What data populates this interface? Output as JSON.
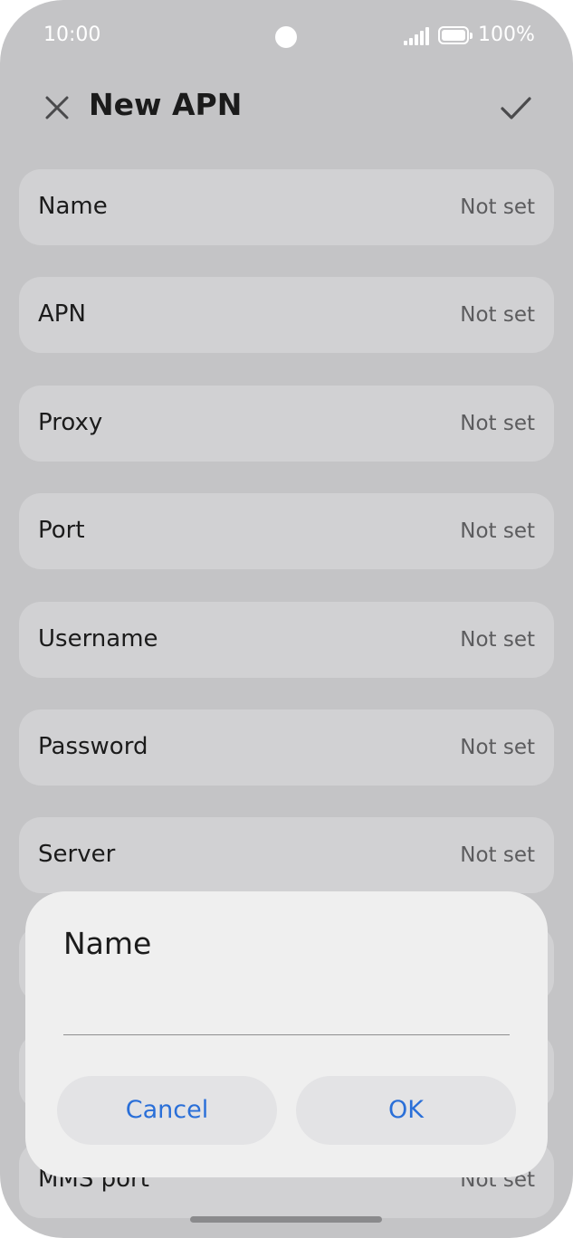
{
  "status_bar": {
    "time": "10:00",
    "battery_percent": "100%"
  },
  "header": {
    "title": "New APN"
  },
  "settings_rows": [
    {
      "label": "Name",
      "value": "Not set"
    },
    {
      "label": "APN",
      "value": "Not set"
    },
    {
      "label": "Proxy",
      "value": "Not set"
    },
    {
      "label": "Port",
      "value": "Not set"
    },
    {
      "label": "Username",
      "value": "Not set"
    },
    {
      "label": "Password",
      "value": "Not set"
    },
    {
      "label": "Server",
      "value": "Not set"
    },
    {
      "label": "",
      "value": ""
    },
    {
      "label": "",
      "value": ""
    },
    {
      "label": "MMS port",
      "value": "Not set"
    }
  ],
  "dialog": {
    "title": "Name",
    "input_value": "",
    "cancel_label": "Cancel",
    "ok_label": "OK"
  },
  "colors": {
    "accent": "#2a6fd8",
    "background_dimmed": "#c4c4c6",
    "row_background": "#d1d1d3",
    "dialog_background": "#efefef"
  },
  "icons": {
    "close": "close-icon",
    "confirm": "checkmark-icon",
    "signal": "signal-icon",
    "battery": "battery-icon"
  }
}
